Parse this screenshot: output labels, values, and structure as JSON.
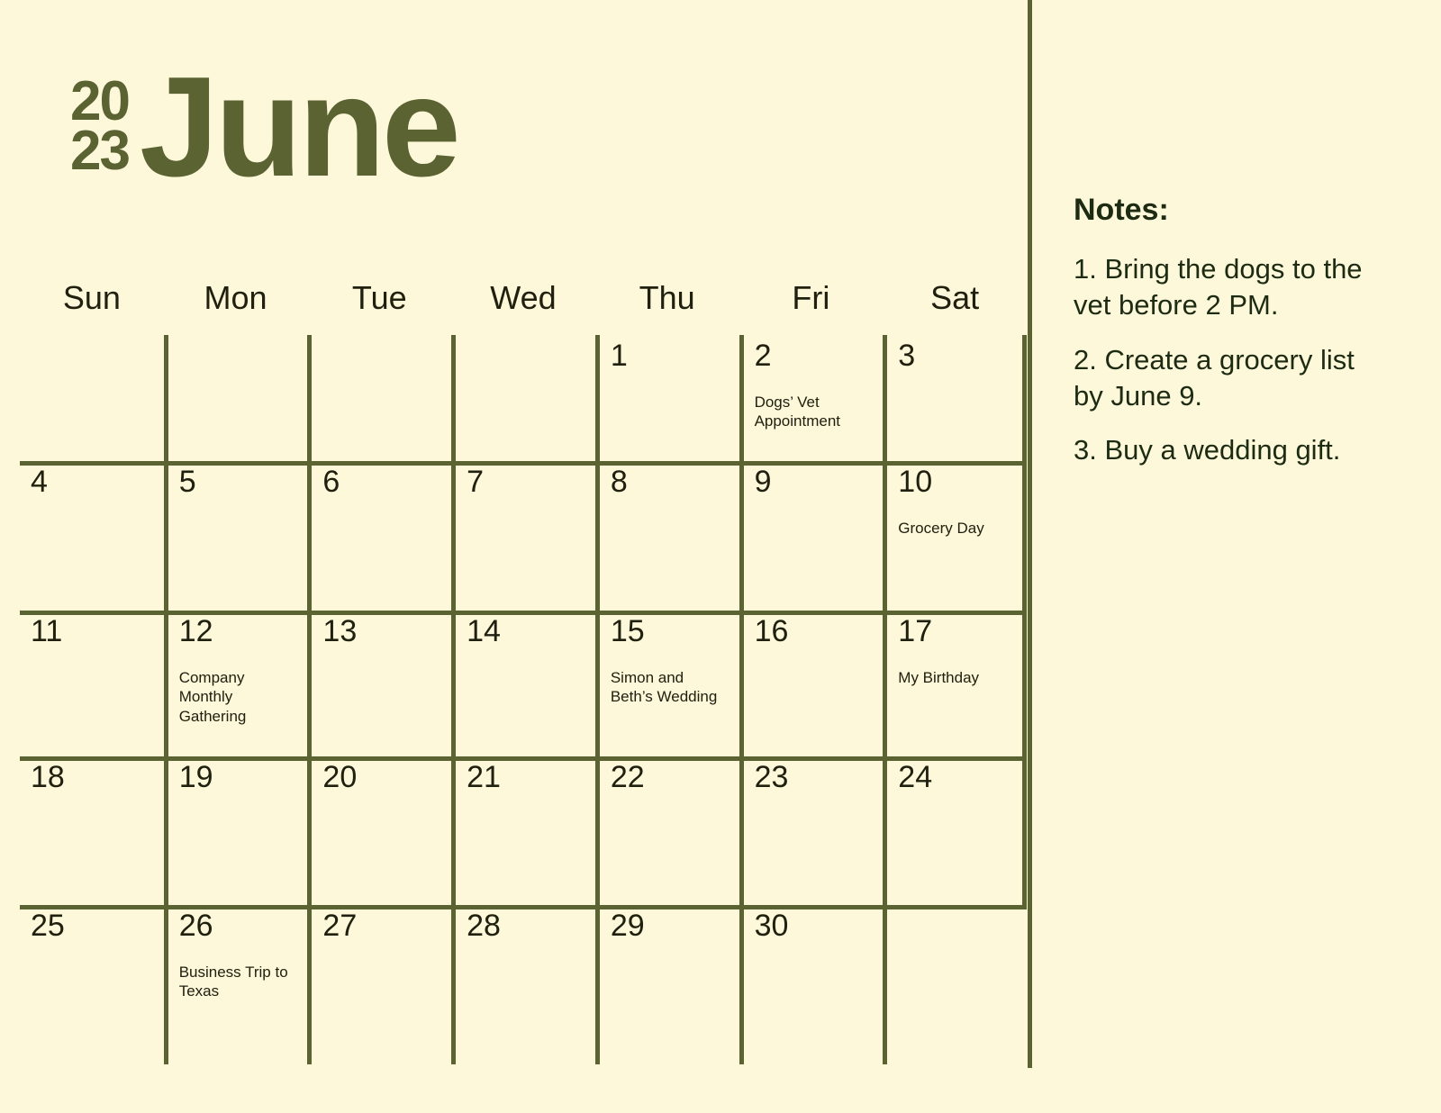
{
  "header": {
    "year_top": "20",
    "year_bottom": "23",
    "month": "June",
    "accent_color": "#5C6332",
    "background_color": "#FDF8DA",
    "text_color": "#20200F"
  },
  "weekdays": [
    "Sun",
    "Mon",
    "Tue",
    "Wed",
    "Thu",
    "Fri",
    "Sat"
  ],
  "weeks": [
    [
      {
        "day": "",
        "event": ""
      },
      {
        "day": "",
        "event": ""
      },
      {
        "day": "",
        "event": ""
      },
      {
        "day": "",
        "event": ""
      },
      {
        "day": "1",
        "event": ""
      },
      {
        "day": "2",
        "event": "Dogs’ Vet Appointment"
      },
      {
        "day": "3",
        "event": ""
      }
    ],
    [
      {
        "day": "4",
        "event": ""
      },
      {
        "day": "5",
        "event": ""
      },
      {
        "day": "6",
        "event": ""
      },
      {
        "day": "7",
        "event": ""
      },
      {
        "day": "8",
        "event": ""
      },
      {
        "day": "9",
        "event": ""
      },
      {
        "day": "10",
        "event": "Grocery Day"
      }
    ],
    [
      {
        "day": "11",
        "event": ""
      },
      {
        "day": "12",
        "event": "Company Monthly Gathering"
      },
      {
        "day": "13",
        "event": ""
      },
      {
        "day": "14",
        "event": ""
      },
      {
        "day": "15",
        "event": "Simon and Beth’s Wedding"
      },
      {
        "day": "16",
        "event": ""
      },
      {
        "day": "17",
        "event": "My Birthday"
      }
    ],
    [
      {
        "day": "18",
        "event": ""
      },
      {
        "day": "19",
        "event": ""
      },
      {
        "day": "20",
        "event": ""
      },
      {
        "day": "21",
        "event": ""
      },
      {
        "day": "22",
        "event": ""
      },
      {
        "day": "23",
        "event": ""
      },
      {
        "day": "24",
        "event": ""
      }
    ],
    [
      {
        "day": "25",
        "event": ""
      },
      {
        "day": "26",
        "event": "Business Trip to Texas"
      },
      {
        "day": "27",
        "event": ""
      },
      {
        "day": "28",
        "event": ""
      },
      {
        "day": "29",
        "event": ""
      },
      {
        "day": "30",
        "event": ""
      },
      {
        "day": "",
        "event": ""
      }
    ]
  ],
  "notes": {
    "title": "Notes:",
    "items": [
      "1. Bring the dogs to the vet before 2 PM.",
      "2. Create a grocery list by June 9.",
      "3. Buy a wedding gift."
    ]
  }
}
